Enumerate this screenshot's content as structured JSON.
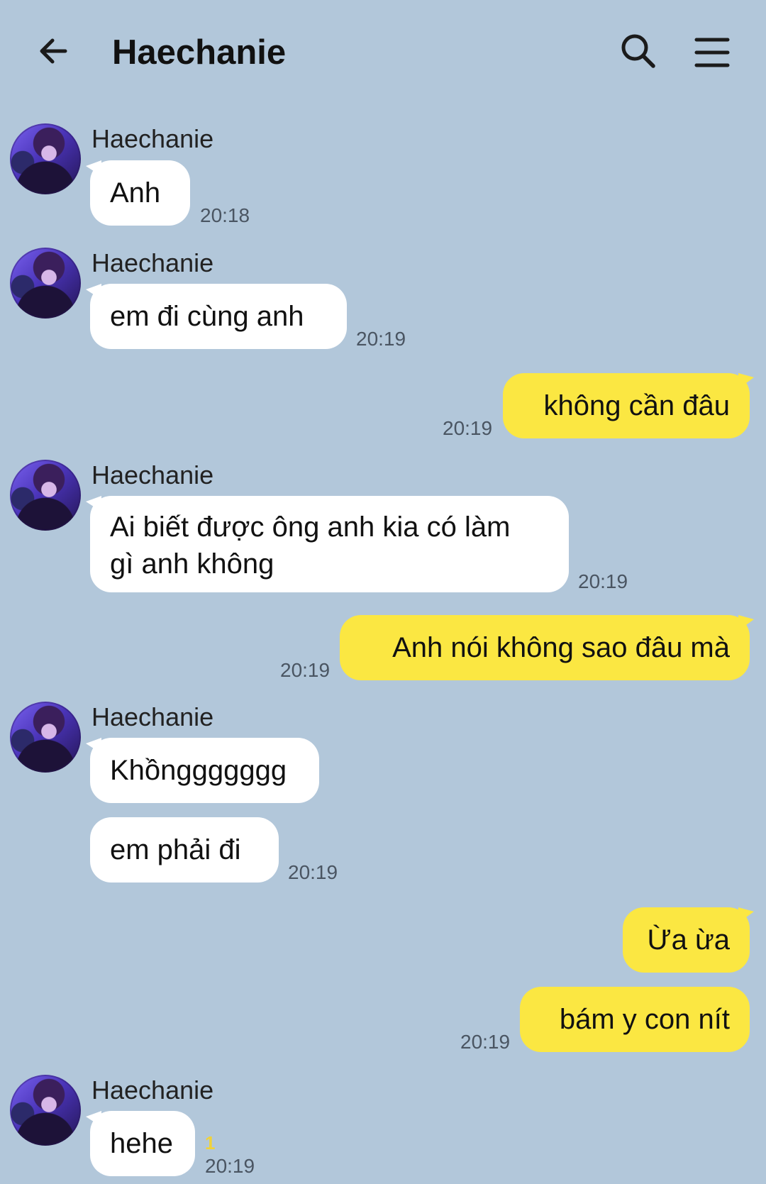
{
  "header": {
    "title": "Haechanie",
    "back_icon": "arrow-left-icon",
    "search_icon": "search-icon",
    "menu_icon": "hamburger-menu-icon"
  },
  "colors": {
    "background": "#b2c7da",
    "incoming_bubble": "#ffffff",
    "outgoing_bubble": "#fbe742",
    "unread": "#f0d23a"
  },
  "messages": [
    {
      "sender": "Haechanie",
      "text": "Anh",
      "time": "20:18"
    },
    {
      "sender": "Haechanie",
      "text": "em đi cùng anh",
      "time": "20:19"
    },
    {
      "text": "không cần đâu",
      "time": "20:19"
    },
    {
      "sender": "Haechanie",
      "line1": "Ai biết được ông anh kia có làm",
      "line2": "gì anh không",
      "time": "20:19"
    },
    {
      "text": "Anh nói không sao đâu mà",
      "time": "20:19"
    },
    {
      "sender": "Haechanie",
      "text": "Khồnggggggg"
    },
    {
      "text": "em phải đi",
      "time": "20:19"
    },
    {
      "text": "Ừa ừa"
    },
    {
      "text": "bám y con nít",
      "time": "20:19"
    },
    {
      "sender": "Haechanie",
      "text": "hehe",
      "unread": "1",
      "time": "20:19"
    }
  ]
}
